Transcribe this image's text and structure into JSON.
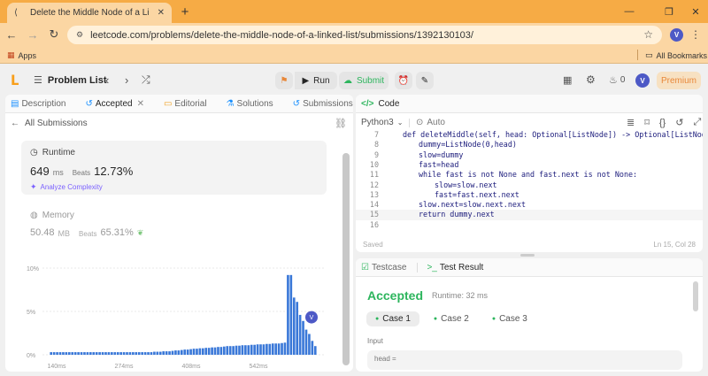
{
  "browser": {
    "tab_title": "Delete the Middle Node of a Li",
    "url": "leetcode.com/problems/delete-the-middle-node-of-a-linked-list/submissions/1392130103/",
    "profile_initial": "V",
    "bookmarks": {
      "apps": "Apps",
      "all_bookmarks": "All Bookmarks"
    }
  },
  "nav": {
    "problem_list": "Problem List",
    "run": "Run",
    "submit": "Submit",
    "streak": "0",
    "avatar": "V",
    "premium": "Premium"
  },
  "left": {
    "tabs": [
      "Description",
      "Accepted",
      "Editorial",
      "Solutions",
      "Submissions"
    ],
    "all_submissions": "All Submissions",
    "runtime": {
      "label": "Runtime",
      "value": "649",
      "unit": "ms",
      "beats_label": "Beats",
      "beats_value": "12.73%",
      "analyze": "Analyze Complexity"
    },
    "memory": {
      "label": "Memory",
      "value": "50.48",
      "unit": "MB",
      "beats_label": "Beats",
      "beats_value": "65.31%"
    }
  },
  "chart_data": {
    "type": "bar",
    "y_ticks": [
      "10%",
      "5%",
      "0%"
    ],
    "x_ticks": [
      "140ms",
      "274ms",
      "408ms",
      "542ms"
    ],
    "ylim": [
      0,
      10
    ],
    "values": [
      0.3,
      0.3,
      0.3,
      0.3,
      0.3,
      0.3,
      0.3,
      0.3,
      0.3,
      0.3,
      0.3,
      0.3,
      0.3,
      0.3,
      0.3,
      0.3,
      0.3,
      0.3,
      0.3,
      0.3,
      0.3,
      0.3,
      0.3,
      0.3,
      0.3,
      0.3,
      0.3,
      0.3,
      0.3,
      0.3,
      0.3,
      0.3,
      0.3,
      0.3,
      0.35,
      0.35,
      0.35,
      0.4,
      0.4,
      0.4,
      0.45,
      0.5,
      0.5,
      0.55,
      0.6,
      0.6,
      0.65,
      0.7,
      0.7,
      0.75,
      0.75,
      0.8,
      0.8,
      0.85,
      0.85,
      0.9,
      0.9,
      0.95,
      1.0,
      1.0,
      1.0,
      1.05,
      1.05,
      1.1,
      1.1,
      1.1,
      1.15,
      1.15,
      1.2,
      1.2,
      1.2,
      1.25,
      1.25,
      1.3,
      1.3,
      1.3,
      1.35,
      1.4,
      9.2,
      9.2,
      6.6,
      6.1,
      4.6,
      3.9,
      2.9,
      2.4,
      1.6,
      1.0
    ],
    "highlight_index": 84,
    "highlight_label": "V"
  },
  "code": {
    "language": "Python3",
    "mode": "Auto",
    "title": "Code",
    "lines": [
      {
        "n": "7",
        "text": "def deleteMiddle(self, head: Optional[ListNode]) -> Optional[ListNode]:",
        "indent": 0
      },
      {
        "n": "8",
        "text": "dummy=ListNode(0,head)",
        "indent": 1
      },
      {
        "n": "9",
        "text": "slow=dummy",
        "indent": 1
      },
      {
        "n": "10",
        "text": "fast=head",
        "indent": 1
      },
      {
        "n": "11",
        "text": "while fast is not None and fast.next is not None:",
        "indent": 1
      },
      {
        "n": "12",
        "text": "slow=slow.next",
        "indent": 2
      },
      {
        "n": "13",
        "text": "fast=fast.next.next",
        "indent": 2
      },
      {
        "n": "14",
        "text": "slow.next=slow.next.next",
        "indent": 1
      },
      {
        "n": "15",
        "text": "return dummy.next",
        "indent": 1
      },
      {
        "n": "16",
        "text": "",
        "indent": 0
      }
    ],
    "saved": "Saved",
    "cursor": "Ln 15, Col 28"
  },
  "result": {
    "tab_testcase": "Testcase",
    "tab_result": "Test Result",
    "status": "Accepted",
    "runtime": "Runtime: 32 ms",
    "cases": [
      "Case 1",
      "Case 2",
      "Case 3"
    ],
    "input_label": "Input",
    "input_value": "head ="
  },
  "colors": {
    "accent_green": "#2db55d",
    "tab_orange": "#f6ab45",
    "bar_blue": "#3a78d8",
    "premium": "#e8883a"
  }
}
